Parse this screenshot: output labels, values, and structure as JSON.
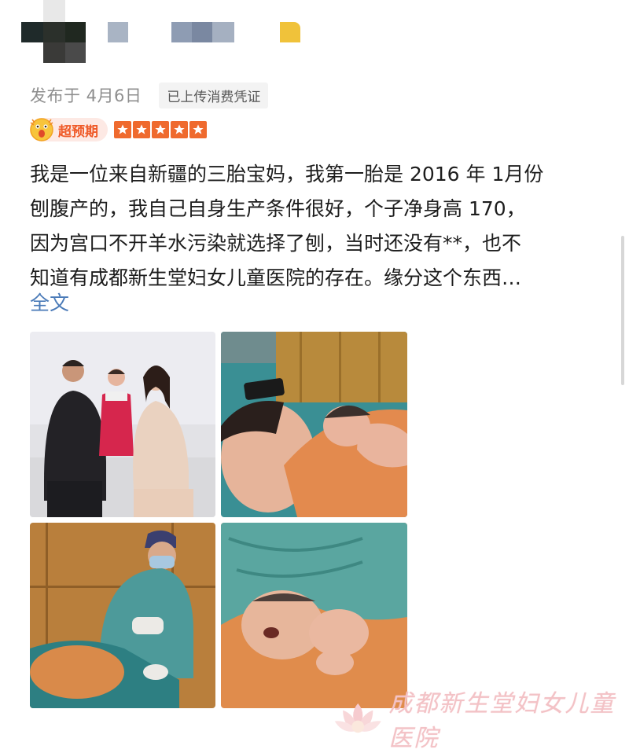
{
  "post": {
    "published": "发布于 4月6日",
    "receipt_tag": "已上传消费凭证"
  },
  "rating": {
    "badge": "超预期",
    "stars": 5
  },
  "review": {
    "lines": [
      "我是一位来自新疆的三胎宝妈，我第一胎是 2016 年 1月份",
      "刨腹产的，我自己自身生产条件很好，个子净身高 170，",
      "因为宫口不开羊水污染就选择了刨，当时还没有**，也不",
      "知道有成都新生堂妇女儿童医院的存在。缘分这个东西…"
    ],
    "expand_label": "全文"
  },
  "watermark": {
    "text": "成都新生堂妇女儿童医院"
  },
  "colors": {
    "accent": "#ef6a2e",
    "link": "#4b7bb8",
    "meta": "#8e8e8e"
  }
}
